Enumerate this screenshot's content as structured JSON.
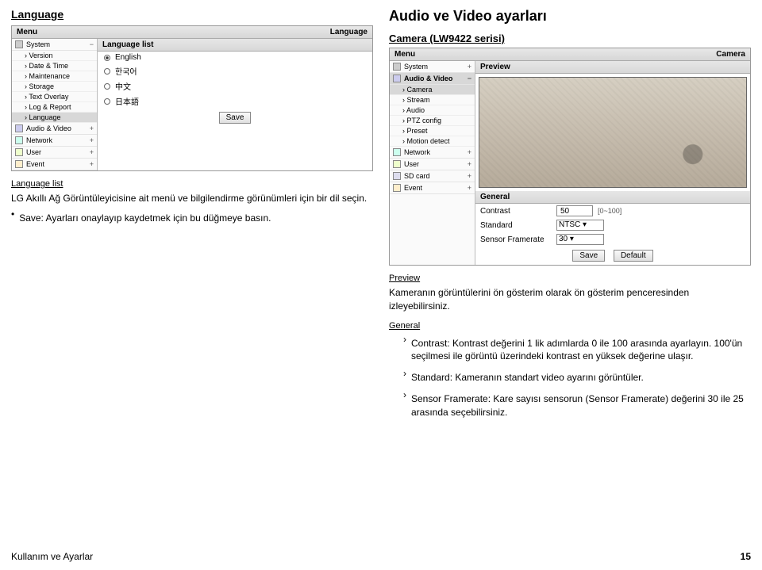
{
  "left": {
    "title": "Language",
    "shot": {
      "menu_label": "Menu",
      "menu_right": "Language",
      "side": {
        "system": "System",
        "subs": [
          "Version",
          "Date & Time",
          "Maintenance",
          "Storage",
          "Text Overlay",
          "Log & Report",
          "Language"
        ],
        "audio": "Audio & Video",
        "network": "Network",
        "user": "User",
        "event": "Event"
      },
      "main_head": "Language list",
      "langs": [
        "English",
        "한국어",
        "中文",
        "日本語"
      ],
      "save": "Save"
    },
    "list_label": "Language list",
    "para1": "LG Akıllı Ağ Görüntüleyicisine ait menü ve bilgilendirme görünümleri için bir dil seçin.",
    "bullet1": "Save: Ayarları onaylayıp kaydetmek için bu düğmeye basın."
  },
  "right": {
    "title": "Audio ve Video ayarları",
    "camera_label": "Camera (LW9422 serisi)",
    "shot": {
      "menu_label": "Menu",
      "menu_right": "Camera",
      "side": {
        "system": "System",
        "audio": "Audio & Video",
        "subs": [
          "Camera",
          "Stream",
          "Audio",
          "PTZ config",
          "Preset",
          "Motion detect"
        ],
        "network": "Network",
        "user": "User",
        "sd": "SD card",
        "event": "Event"
      },
      "preview_head": "Preview",
      "general_head": "General",
      "rows": {
        "contrast_label": "Contrast",
        "contrast_value": "50",
        "contrast_hint": "[0~100]",
        "standard_label": "Standard",
        "standard_value": "NTSC",
        "fps_label": "Sensor Framerate",
        "fps_value": "30"
      },
      "save": "Save",
      "default": "Default"
    },
    "preview_label": "Preview",
    "preview_text": "Kameranın görüntülerini ön gösterim olarak ön gösterim penceresinden izleyebilirsiniz.",
    "general_label": "General",
    "g1": "Contrast: Kontrast değerini 1 lik adımlarda 0 ile 100 arasında ayarlayın. 100'ün seçilmesi ile görüntü üzerindeki kontrast en yüksek değerine ulaşır.",
    "g2": "Standard: Kameranın standart video ayarını görüntüler.",
    "g3": "Sensor Framerate: Kare sayısı sensorun (Sensor Framerate) değerini 30 ile 25 arasında seçebilirsiniz."
  },
  "footer": {
    "section": "Kullanım ve Ayarlar",
    "page": "15"
  }
}
